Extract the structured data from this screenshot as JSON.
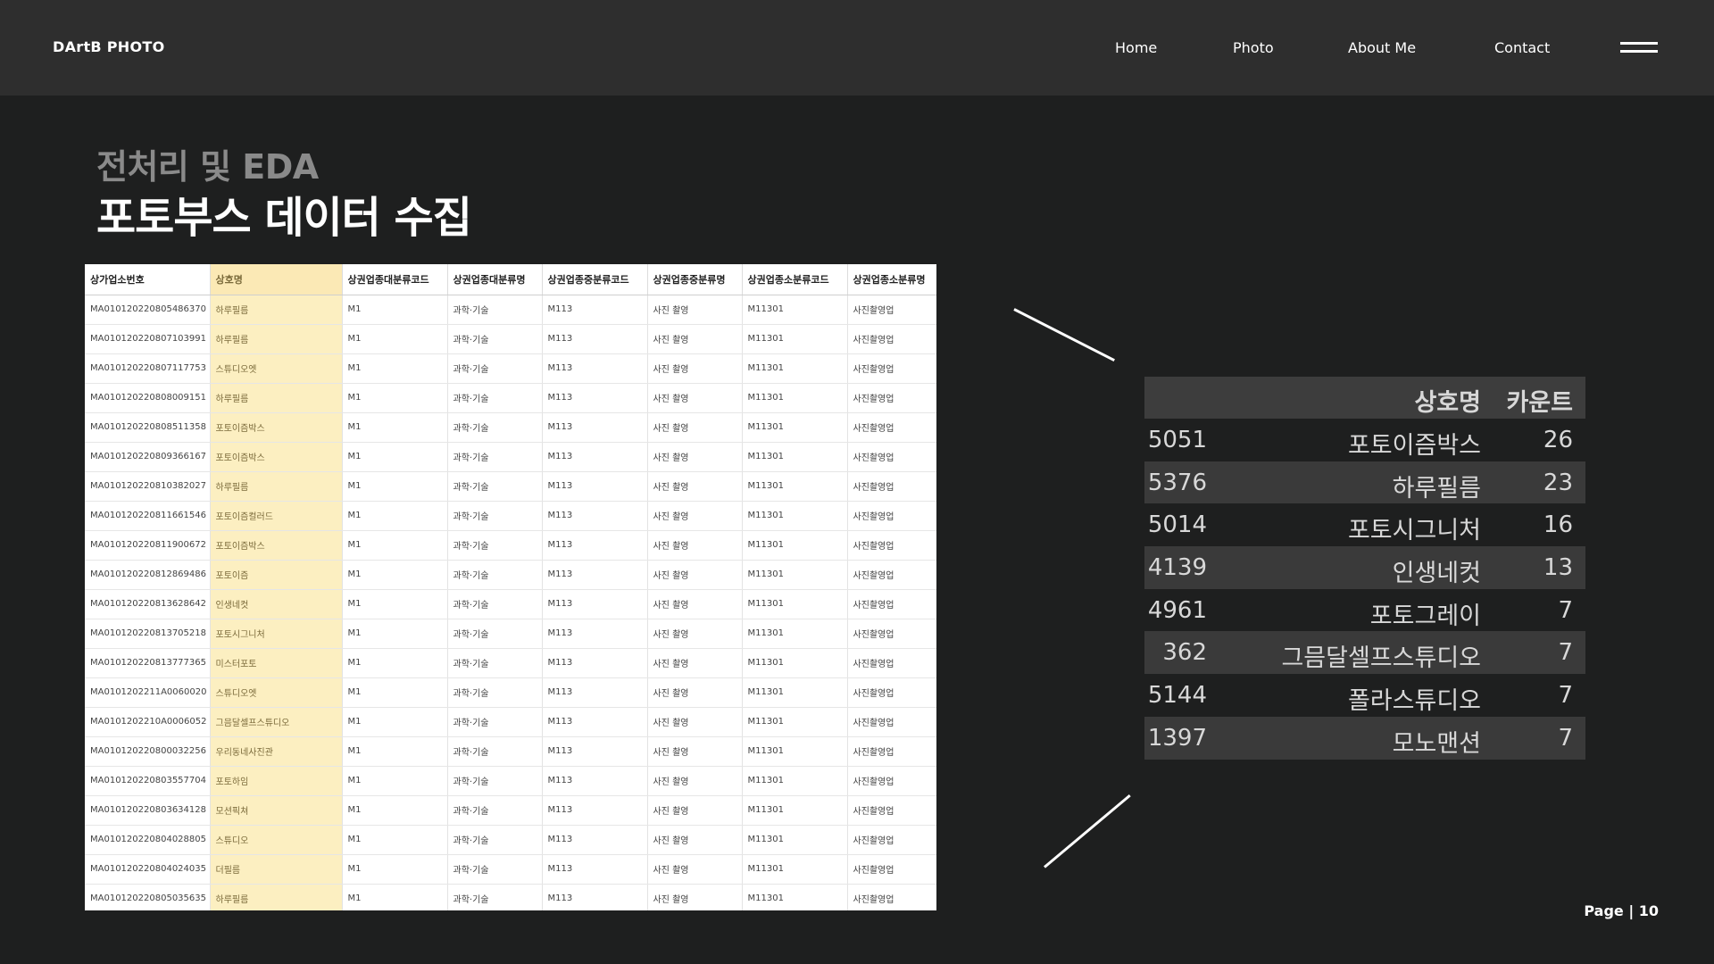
{
  "navbar": {
    "brand": "DArtB PHOTO",
    "links": [
      "Home",
      "Photo",
      "About Me",
      "Contact"
    ]
  },
  "heading": {
    "subtitle": "전처리 및 EDA",
    "title": "포토부스 데이터 수집"
  },
  "raw_table": {
    "columns": [
      "상가업소번호",
      "상호명",
      "상권업종대분류코드",
      "상권업종대분류명",
      "상권업종중분류코드",
      "상권업종중분류명",
      "상권업종소분류코드",
      "상권업종소분류명"
    ],
    "rows": [
      [
        "MA010120220805486370",
        "하루필름",
        "M1",
        "과학·기술",
        "M113",
        "사진 촬영",
        "M11301",
        "사진촬영업"
      ],
      [
        "MA010120220807103991",
        "하루필름",
        "M1",
        "과학·기술",
        "M113",
        "사진 촬영",
        "M11301",
        "사진촬영업"
      ],
      [
        "MA010120220807117753",
        "스튜디오엣",
        "M1",
        "과학·기술",
        "M113",
        "사진 촬영",
        "M11301",
        "사진촬영업"
      ],
      [
        "MA010120220808009151",
        "하루필름",
        "M1",
        "과학·기술",
        "M113",
        "사진 촬영",
        "M11301",
        "사진촬영업"
      ],
      [
        "MA010120220808511358",
        "포토이즘박스",
        "M1",
        "과학·기술",
        "M113",
        "사진 촬영",
        "M11301",
        "사진촬영업"
      ],
      [
        "MA010120220809366167",
        "포토이즘박스",
        "M1",
        "과학·기술",
        "M113",
        "사진 촬영",
        "M11301",
        "사진촬영업"
      ],
      [
        "MA010120220810382027",
        "하루필름",
        "M1",
        "과학·기술",
        "M113",
        "사진 촬영",
        "M11301",
        "사진촬영업"
      ],
      [
        "MA010120220811661546",
        "포토이즘컬러드",
        "M1",
        "과학·기술",
        "M113",
        "사진 촬영",
        "M11301",
        "사진촬영업"
      ],
      [
        "MA010120220811900672",
        "포토이즘박스",
        "M1",
        "과학·기술",
        "M113",
        "사진 촬영",
        "M11301",
        "사진촬영업"
      ],
      [
        "MA010120220812869486",
        "포토이즘",
        "M1",
        "과학·기술",
        "M113",
        "사진 촬영",
        "M11301",
        "사진촬영업"
      ],
      [
        "MA010120220813628642",
        "인생네컷",
        "M1",
        "과학·기술",
        "M113",
        "사진 촬영",
        "M11301",
        "사진촬영업"
      ],
      [
        "MA010120220813705218",
        "포토시그니처",
        "M1",
        "과학·기술",
        "M113",
        "사진 촬영",
        "M11301",
        "사진촬영업"
      ],
      [
        "MA010120220813777365",
        "미스터포토",
        "M1",
        "과학·기술",
        "M113",
        "사진 촬영",
        "M11301",
        "사진촬영업"
      ],
      [
        "MA0101202211A0060020",
        "스튜디오엣",
        "M1",
        "과학·기술",
        "M113",
        "사진 촬영",
        "M11301",
        "사진촬영업"
      ],
      [
        "MA0101202210A0006052",
        "그믐달셀프스튜디오",
        "M1",
        "과학·기술",
        "M113",
        "사진 촬영",
        "M11301",
        "사진촬영업"
      ],
      [
        "MA010120220800032256",
        "우리동네사진관",
        "M1",
        "과학·기술",
        "M113",
        "사진 촬영",
        "M11301",
        "사진촬영업"
      ],
      [
        "MA010120220803557704",
        "포토하임",
        "M1",
        "과학·기술",
        "M113",
        "사진 촬영",
        "M11301",
        "사진촬영업"
      ],
      [
        "MA010120220803634128",
        "모션픽쳐",
        "M1",
        "과학·기술",
        "M113",
        "사진 촬영",
        "M11301",
        "사진촬영업"
      ],
      [
        "MA010120220804028805",
        "스튜디오",
        "M1",
        "과학·기술",
        "M113",
        "사진 촬영",
        "M11301",
        "사진촬영업"
      ],
      [
        "MA010120220804024035",
        "더필름",
        "M1",
        "과학·기술",
        "M113",
        "사진 촬영",
        "M11301",
        "사진촬영업"
      ],
      [
        "MA010120220805035635",
        "하루필름",
        "M1",
        "과학·기술",
        "M113",
        "사진 촬영",
        "M11301",
        "사진촬영업"
      ]
    ]
  },
  "count_table": {
    "header_name": "상호명",
    "header_count": "카운트",
    "rows": [
      {
        "index": "5051",
        "name": "포토이즘박스",
        "count": "26"
      },
      {
        "index": "5376",
        "name": "하루필름",
        "count": "23"
      },
      {
        "index": "5014",
        "name": "포토시그니처",
        "count": "16"
      },
      {
        "index": "4139",
        "name": "인생네컷",
        "count": "13"
      },
      {
        "index": "4961",
        "name": "포토그레이",
        "count": "7"
      },
      {
        "index": "362",
        "name": "그믐달셀프스튜디오",
        "count": "7"
      },
      {
        "index": "5144",
        "name": "폴라스튜디오",
        "count": "7"
      },
      {
        "index": "1397",
        "name": "모노맨션",
        "count": "7"
      }
    ]
  },
  "footer": {
    "page_label": "Page | 10"
  },
  "colors": {
    "navbar_bg": "#2e2e2e",
    "page_bg": "#1e1f1f",
    "highlight": "#fcefc1",
    "count_row_alt": "#3a3a3a"
  },
  "icons": [
    "hamburger-menu-icon"
  ]
}
